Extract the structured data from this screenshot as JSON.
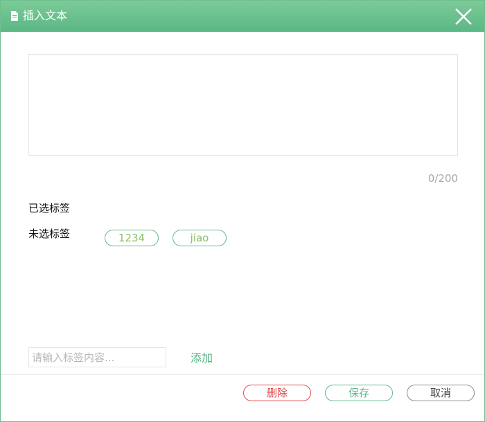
{
  "dialog": {
    "title": "插入文本",
    "title_icon": "document-icon",
    "close_icon": "close-icon",
    "accent_color": "#5bb785"
  },
  "editor": {
    "value": "",
    "counter": "0/200"
  },
  "tags": {
    "selected_label": "已选标签",
    "unselected_label": "未选标签",
    "unselected": [
      "1234",
      "jiao"
    ]
  },
  "add_tag": {
    "placeholder": "请输入标签内容...",
    "value": "",
    "add_label": "添加"
  },
  "footer": {
    "delete_label": "删除",
    "delete_color": "#e04848",
    "save_label": "保存",
    "cancel_label": "取消"
  }
}
